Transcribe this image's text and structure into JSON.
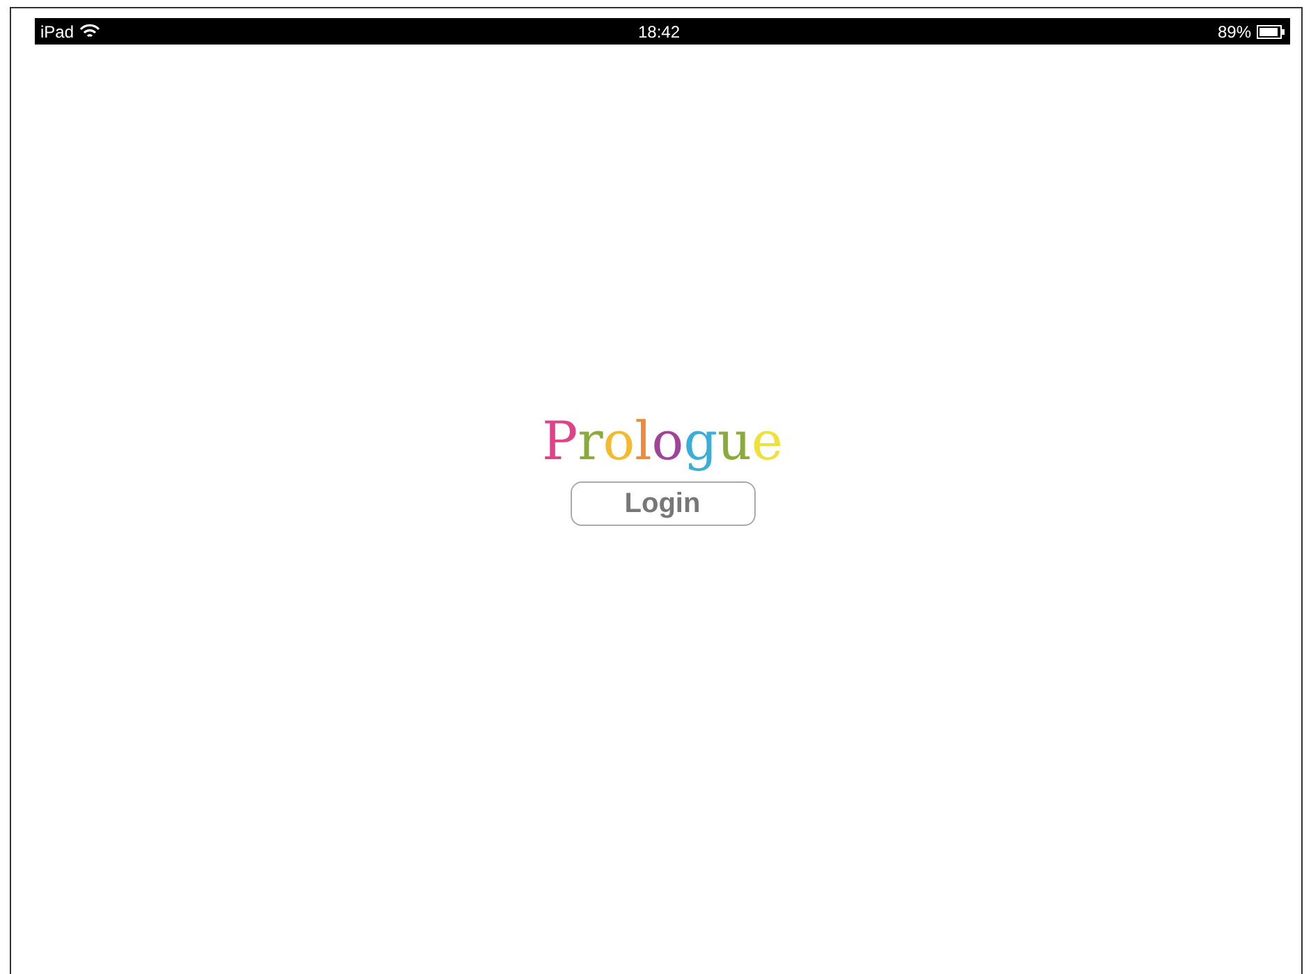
{
  "status_bar": {
    "device": "iPad",
    "time": "18:42",
    "battery": "89%"
  },
  "logo": {
    "letters": [
      {
        "char": "P",
        "color": "#e0428a"
      },
      {
        "char": "r",
        "color": "#8aab3c"
      },
      {
        "char": "o",
        "color": "#f5b92e"
      },
      {
        "char": "l",
        "color": "#ee8a3a"
      },
      {
        "char": "o",
        "color": "#a2439a"
      },
      {
        "char": "g",
        "color": "#3aaed8"
      },
      {
        "char": "u",
        "color": "#8aab3c"
      },
      {
        "char": "e",
        "color": "#f0e13a"
      }
    ]
  },
  "login_button": {
    "label": "Login"
  }
}
